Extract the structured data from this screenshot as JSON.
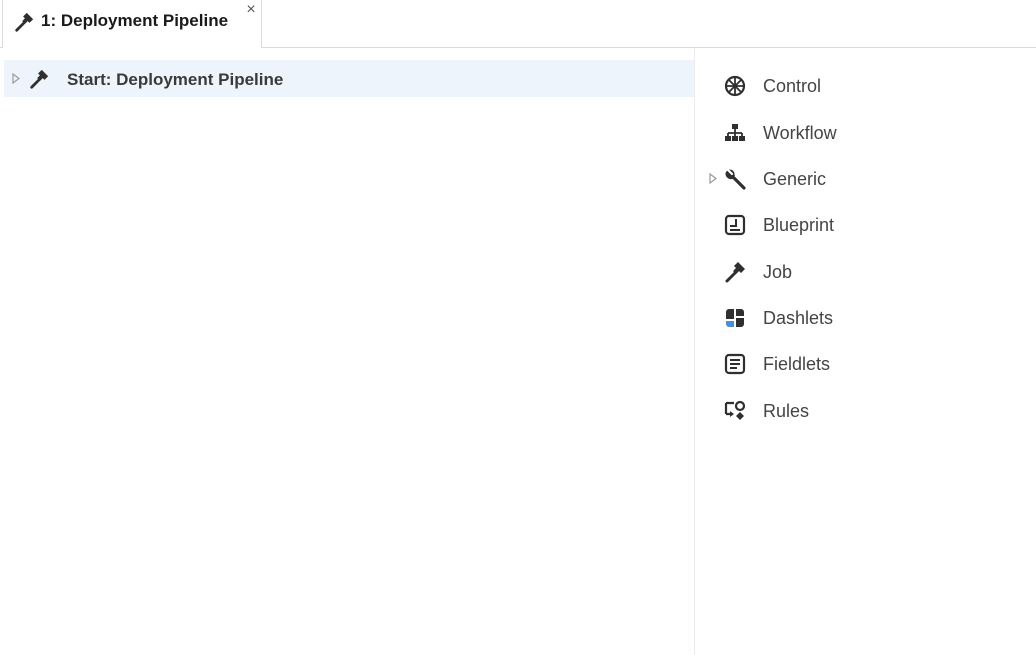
{
  "tab": {
    "label": "1: Deployment Pipeline",
    "icon": "hammer-icon",
    "close_glyph": "×"
  },
  "tree": {
    "root_label": "Start: Deployment Pipeline",
    "icon": "hammer-icon"
  },
  "palette": {
    "items": [
      {
        "label": "Control",
        "icon": "wheel-icon",
        "expandable": false
      },
      {
        "label": "Workflow",
        "icon": "sitemap-icon",
        "expandable": false
      },
      {
        "label": "Generic",
        "icon": "wrench-icon",
        "expandable": true
      },
      {
        "label": "Blueprint",
        "icon": "blueprint-icon",
        "expandable": false
      },
      {
        "label": "Job",
        "icon": "hammer-icon",
        "expandable": false
      },
      {
        "label": "Dashlets",
        "icon": "dashlets-icon",
        "expandable": false
      },
      {
        "label": "Fieldlets",
        "icon": "fieldlets-icon",
        "expandable": false
      },
      {
        "label": "Rules",
        "icon": "rules-icon",
        "expandable": false
      }
    ]
  },
  "colors": {
    "selected_row": "#eef4fc",
    "icon_dark": "#2f2f2f",
    "dashlets_accent": "#4a90d9"
  }
}
